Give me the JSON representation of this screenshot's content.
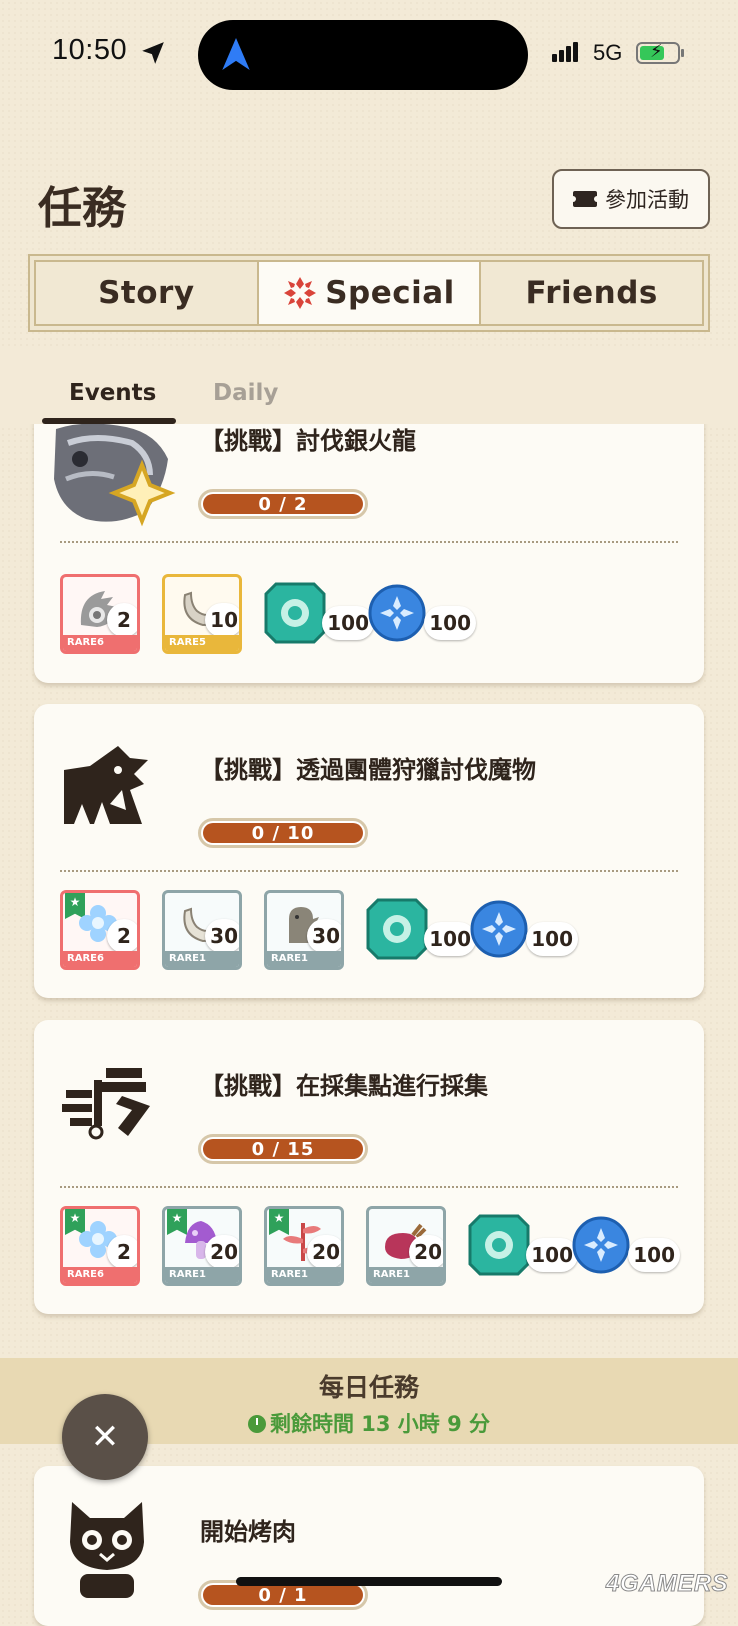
{
  "status_bar": {
    "time": "10:50",
    "network": "5G"
  },
  "header": {
    "title": "任務",
    "join_button": "參加活動"
  },
  "tabs": [
    {
      "label": "Story",
      "active": false
    },
    {
      "label": "Special",
      "active": true
    },
    {
      "label": "Friends",
      "active": false
    }
  ],
  "subtabs": {
    "events": "Events",
    "daily": "Daily"
  },
  "quests": [
    {
      "title": "【挑戰】討伐銀火龍",
      "progress": "0 / 2",
      "progress_fraction": 0,
      "rewards": [
        {
          "rarity": "RARE6",
          "count": "2",
          "icon": "shell-material-icon"
        },
        {
          "rarity": "RARE5",
          "count": "10",
          "icon": "claw-material-icon"
        },
        {
          "count": "100",
          "icon": "green-gem-icon"
        },
        {
          "count": "100",
          "icon": "blue-orb-icon"
        }
      ]
    },
    {
      "title": "【挑戰】透過團體狩獵討伐魔物",
      "progress": "0 / 10",
      "progress_fraction": 0,
      "rewards": [
        {
          "rarity": "RARE6",
          "count": "2",
          "icon": "crystal-flower-icon",
          "starred": true
        },
        {
          "rarity": "RARE1",
          "count": "30",
          "icon": "claw-material-icon"
        },
        {
          "rarity": "RARE1",
          "count": "30",
          "icon": "scale-material-icon"
        },
        {
          "count": "100",
          "icon": "green-gem-icon"
        },
        {
          "count": "100",
          "icon": "blue-orb-icon"
        }
      ]
    },
    {
      "title": "【挑戰】在採集點進行採集",
      "progress": "0 / 15",
      "progress_fraction": 0,
      "rewards": [
        {
          "rarity": "RARE6",
          "count": "2",
          "icon": "crystal-flower-icon",
          "starred": true
        },
        {
          "rarity": "RARE1",
          "count": "20",
          "icon": "mushroom-icon",
          "starred": true
        },
        {
          "rarity": "RARE1",
          "count": "20",
          "icon": "herb-icon",
          "starred": true
        },
        {
          "rarity": "RARE1",
          "count": "20",
          "icon": "meat-icon"
        },
        {
          "count": "100",
          "icon": "green-gem-icon"
        },
        {
          "count": "100",
          "icon": "blue-orb-icon"
        }
      ]
    }
  ],
  "daily": {
    "title": "每日任務",
    "time_remaining": "剩餘時間 13 小時 9 分",
    "quest_title": "開始烤肉",
    "quest_progress": "0 / 1"
  },
  "watermark": "4GAMERS",
  "colors": {
    "background": "#f3ead7",
    "progress": "#b6541f",
    "rare6": "#ef6f6f",
    "rare5": "#e9b73b",
    "rare1": "#8ea5a8",
    "time_green": "#4a9a3a"
  }
}
